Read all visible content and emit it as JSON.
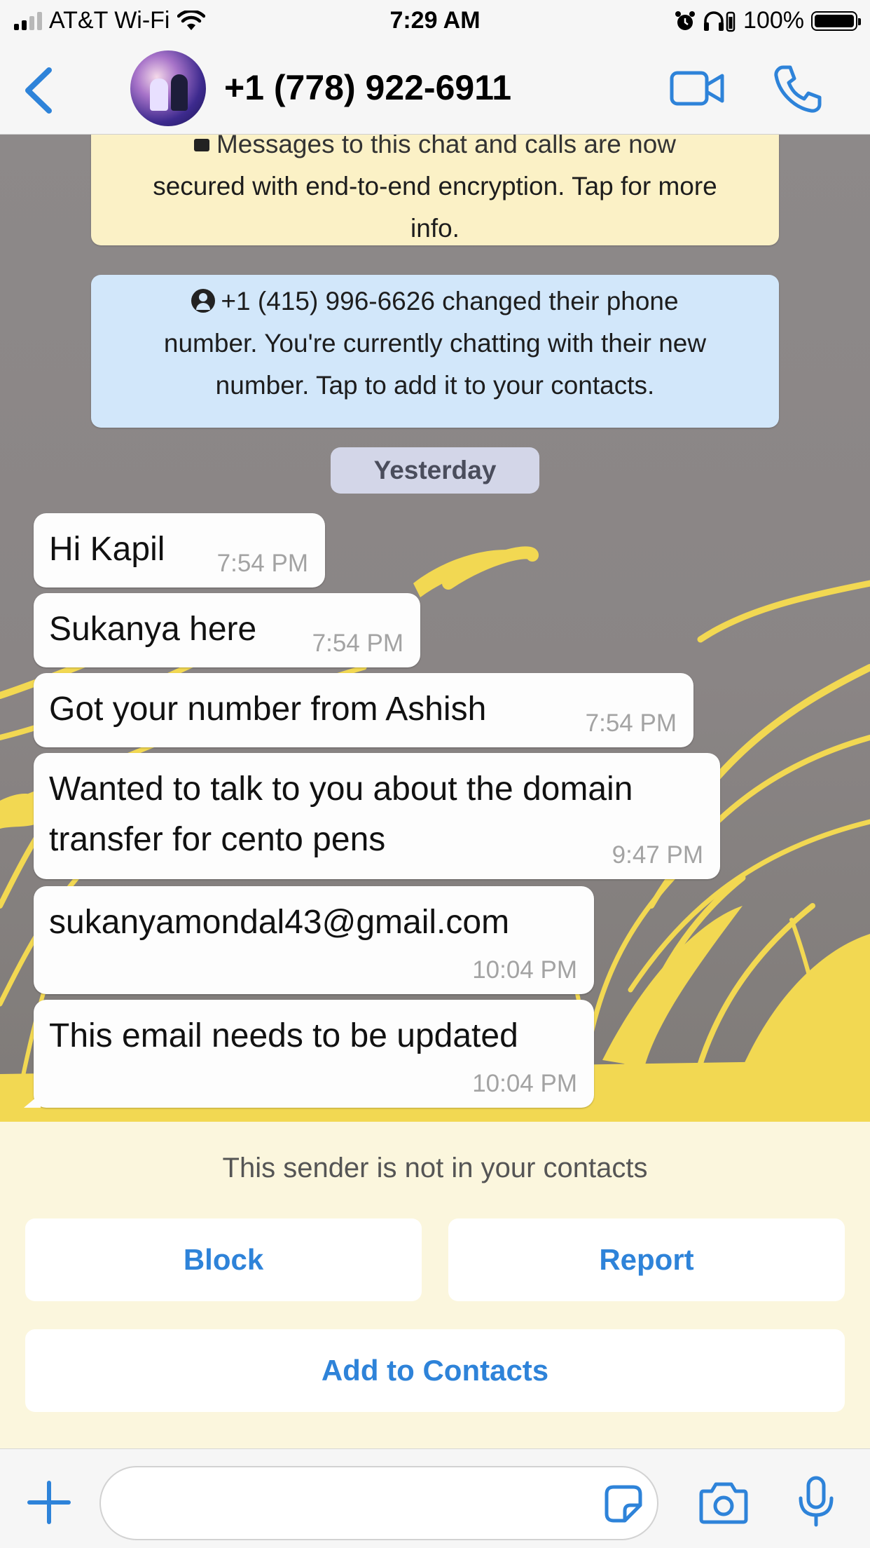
{
  "status_bar": {
    "carrier": "AT&T Wi-Fi",
    "time": "7:29 AM",
    "battery": "100%"
  },
  "header": {
    "contact_name": "+1 (778) 922-6911"
  },
  "chat": {
    "encryption_notice": {
      "line1": "Messages to this chat and calls are now",
      "line2": "secured with end-to-end encryption. Tap for more",
      "line3": "info."
    },
    "number_change_notice": {
      "line1": "+1 (415) 996-6626 changed their phone",
      "line2": "number. You're currently chatting with their new",
      "line3": "number. Tap to add it to your contacts."
    },
    "date_separator": "Yesterday",
    "messages": [
      {
        "text": "Hi Kapil",
        "time": "7:54 PM"
      },
      {
        "text": "Sukanya here",
        "time": "7:54 PM"
      },
      {
        "text": "Got your number from Ashish",
        "time": "7:54 PM"
      },
      {
        "text_line1": "Wanted to talk to you about the domain",
        "text_line2": "transfer for cento pens",
        "time": "9:47 PM"
      },
      {
        "text": "sukanyamondal43@gmail.com",
        "time": "10:04 PM"
      },
      {
        "text": "This email needs to be updated",
        "time": "10:04 PM"
      }
    ]
  },
  "unknown_sender_panel": {
    "message": "This sender is not in your contacts",
    "block_label": "Block",
    "report_label": "Report",
    "add_label": "Add to Contacts"
  },
  "input_bar": {
    "value": ""
  },
  "colors": {
    "accent": "#2e83d9",
    "encryption_bg": "#fbf1c6",
    "notice_bg": "#d2e7fa",
    "panel_bg": "#fbf6dd",
    "wallpaper_grass": "#f2d852"
  }
}
